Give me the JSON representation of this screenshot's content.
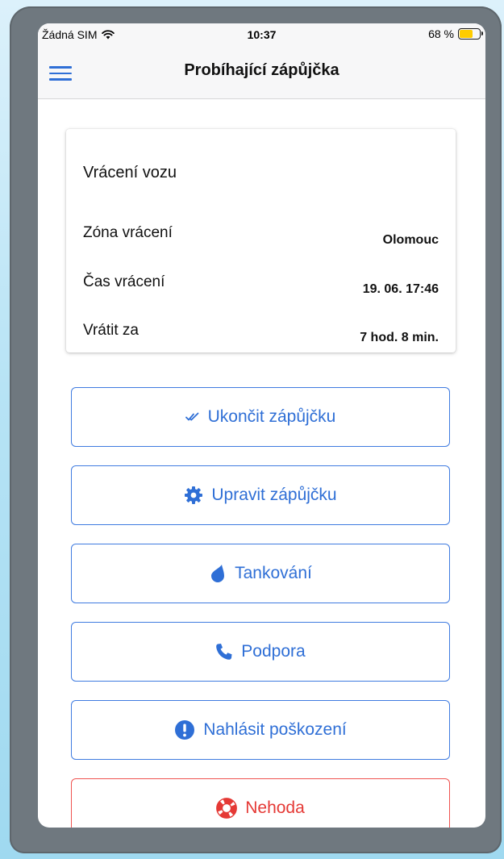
{
  "status_bar": {
    "carrier": "Žádná SIM",
    "time": "10:37",
    "battery": "68 %"
  },
  "header": {
    "title": "Probíhající zápůjčka"
  },
  "return_card": {
    "title": "Vrácení vozu",
    "rows": [
      {
        "label": "Zóna vrácení",
        "value": "Olomouc"
      },
      {
        "label": "Čas vrácení",
        "value": "19. 06. 17:46"
      },
      {
        "label": "Vrátit za",
        "value": "7 hod. 8 min."
      }
    ]
  },
  "actions": [
    {
      "label": "Ukončit zápůjčku",
      "icon": "double-check-icon"
    },
    {
      "label": "Upravit zápůjčku",
      "icon": "gear-icon"
    },
    {
      "label": "Tankování",
      "icon": "drop-icon"
    },
    {
      "label": "Podpora",
      "icon": "phone-icon"
    },
    {
      "label": "Nahlásit poškození",
      "icon": "exclamation-circle-icon"
    },
    {
      "label": "Nehoda",
      "icon": "lifebuoy-icon"
    }
  ],
  "colors": {
    "accent": "#2f6fd6",
    "danger": "#e53935",
    "battery": "#ffcc00"
  }
}
